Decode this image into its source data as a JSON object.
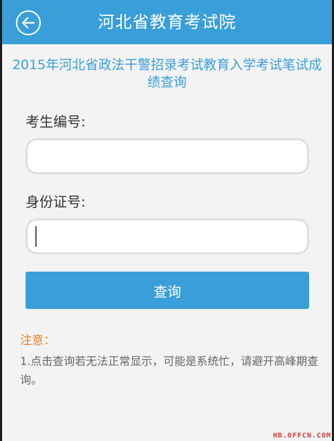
{
  "header": {
    "title": "河北省教育考试院",
    "back_icon": "back-arrow-icon",
    "color": "#3a9fd9"
  },
  "page": {
    "title": "2015年河北省政法干警招录考试教育入学考试笔试成绩查询"
  },
  "form": {
    "exam_number_label": "考生编号:",
    "exam_number_value": "",
    "id_number_label": "身份证号:",
    "id_number_value": "",
    "submit_label": "查询"
  },
  "notice": {
    "title": "注意：",
    "body": "1.点击查询若无法正常显示，可能是系统忙，请避开高峰期查询。"
  },
  "watermark": "HB.OFFCN.COM"
}
